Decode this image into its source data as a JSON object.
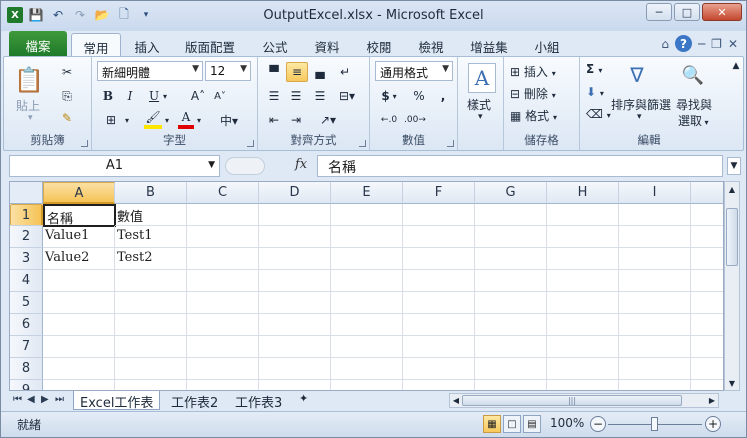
{
  "window": {
    "title": "OutputExcel.xlsx - Microsoft Excel"
  },
  "ribbon_tabs": [
    "檔案",
    "常用",
    "插入",
    "版面配置",
    "公式",
    "資料",
    "校閱",
    "檢視",
    "增益集",
    "小組"
  ],
  "clipboard": {
    "paste": "貼上",
    "label": "剪貼簿"
  },
  "font": {
    "name": "新細明體",
    "size": "12",
    "label": "字型"
  },
  "alignment": {
    "label": "對齊方式"
  },
  "number": {
    "format": "通用格式",
    "label": "數值",
    "currency": "$",
    "percent": "%",
    "comma": ","
  },
  "styles": {
    "label": "樣式"
  },
  "cells": {
    "insert": "插入",
    "delete": "刪除",
    "format": "格式",
    "label": "儲存格"
  },
  "editing": {
    "sort": "排序與篩選",
    "find_l1": "尋找與",
    "find_l2": "選取",
    "label": "編輯",
    "sum": "Σ"
  },
  "formula_bar": {
    "name_box": "A1",
    "fx": "fx",
    "content": "名稱"
  },
  "columns": [
    "A",
    "B",
    "C",
    "D",
    "E",
    "F",
    "G",
    "H",
    "I"
  ],
  "rows": [
    "1",
    "2",
    "3",
    "4",
    "5",
    "6",
    "7",
    "8",
    "9"
  ],
  "cells_data": {
    "A1": "名稱",
    "B1": "數值",
    "A2": "Value1",
    "B2": "Test1",
    "A3": "Value2",
    "B3": "Test2"
  },
  "sheets": [
    "Excel工作表",
    "工作表2",
    "工作表3"
  ],
  "status": {
    "ready": "就緒",
    "zoom": "100%"
  }
}
